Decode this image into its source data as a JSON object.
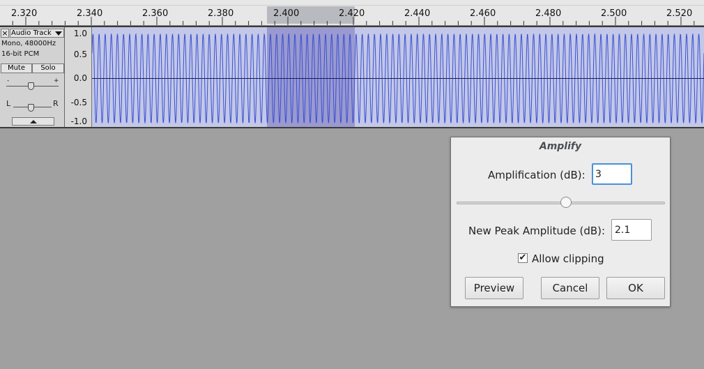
{
  "ruler": {
    "ticks": [
      "2.320",
      "2.340",
      "2.360",
      "2.380",
      "2.400",
      "2.420",
      "2.440",
      "2.460",
      "2.480",
      "2.500",
      "2.520"
    ]
  },
  "track": {
    "close_symbol": "×",
    "name": "Audio Track",
    "info_line1": "Mono, 48000Hz",
    "info_line2": "16-bit PCM",
    "mute_label": "Mute",
    "solo_label": "Solo",
    "gain_minus": "-",
    "gain_plus": "+",
    "pan_left": "L",
    "pan_right": "R"
  },
  "vruler": {
    "labels": [
      "1.0",
      "0.5",
      "0.0",
      "-0.5",
      "-1.0"
    ]
  },
  "waveform": {
    "color": "#3a4fd0",
    "selection_color": "#9a9ad0",
    "cycles_visible": 100
  },
  "dialog": {
    "title": "Amplify",
    "amplification_label": "Amplification (dB):",
    "amplification_value": "3",
    "new_peak_label": "New Peak Amplitude (dB):",
    "new_peak_value": "2.1",
    "allow_clipping_label": "Allow clipping",
    "allow_clipping_checked": true,
    "check_mark": "✔",
    "slider_position": 0.52,
    "preview_label": "Preview",
    "cancel_label": "Cancel",
    "ok_label": "OK"
  }
}
